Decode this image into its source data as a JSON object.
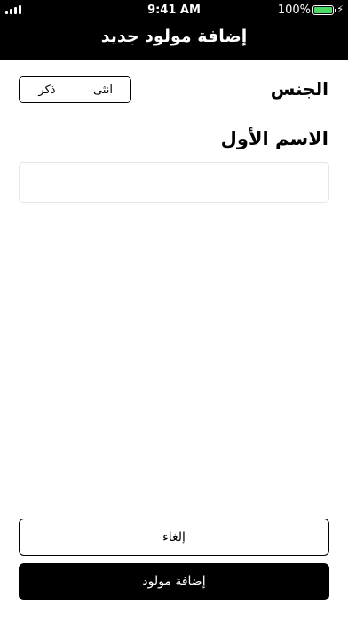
{
  "status_bar": {
    "time": "9:41 AM",
    "battery_percent": "100%",
    "battery_level": 1.0,
    "icons": [
      "signal-icon",
      "battery-icon",
      "charging-bolt-icon"
    ]
  },
  "nav": {
    "title": "إضافة مولود جديد"
  },
  "form": {
    "gender_label": "الجنس",
    "gender_options": [
      "ذكر",
      "انثى"
    ],
    "first_name_label": "الاسم الأول",
    "first_name_value": "",
    "first_name_placeholder": ""
  },
  "actions": {
    "cancel_label": "إلغاء",
    "add_label": "إضافة مولود"
  },
  "colors": {
    "header_bg": "#000000",
    "battery_fill": "#4cd964",
    "primary_button_bg": "#000000"
  }
}
